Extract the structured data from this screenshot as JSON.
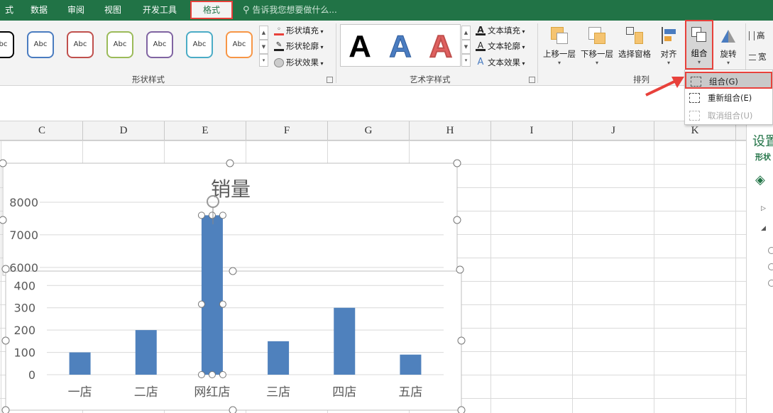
{
  "tabs": [
    {
      "label": "式",
      "active": false
    },
    {
      "label": "数据",
      "active": false
    },
    {
      "label": "审阅",
      "active": false
    },
    {
      "label": "视图",
      "active": false
    },
    {
      "label": "开发工具",
      "active": false
    },
    {
      "label": "格式",
      "active": true
    }
  ],
  "tell_me": "告诉我您想要做什么...",
  "ribbon": {
    "shape_styles": {
      "label": "形状样式",
      "swatches": [
        {
          "text": "Abc",
          "color": "#000000"
        },
        {
          "text": "Abc",
          "color": "#4a7cc0"
        },
        {
          "text": "Abc",
          "color": "#c0504d"
        },
        {
          "text": "Abc",
          "color": "#9bbb59"
        },
        {
          "text": "Abc",
          "color": "#8064a2"
        },
        {
          "text": "Abc",
          "color": "#4bacc6"
        },
        {
          "text": "Abc",
          "color": "#f79646"
        }
      ],
      "fill": "形状填充",
      "outline": "形状轮廓",
      "effects": "形状效果"
    },
    "wordart": {
      "label": "艺术字样式",
      "letters": [
        {
          "text": "A",
          "color": "#000000"
        },
        {
          "text": "A",
          "color": "#4a7cc0"
        },
        {
          "text": "A",
          "color": "#e06060"
        }
      ],
      "fill": "文本填充",
      "outline": "文本轮廓",
      "effects": "文本效果"
    },
    "arrange": {
      "label": "排列",
      "bring_forward": "上移一层",
      "send_backward": "下移一层",
      "selection_pane": "选择窗格",
      "align": "对齐",
      "group": "组合",
      "rotate": "旋转"
    },
    "size": {
      "height_label": "高",
      "width_label": "宽"
    }
  },
  "group_menu": [
    {
      "label": "组合(G)",
      "enabled": true,
      "highlight": true
    },
    {
      "label": "重新组合(E)",
      "enabled": true,
      "highlight": false
    },
    {
      "label": "取消组合(U)",
      "enabled": false,
      "highlight": false
    }
  ],
  "columns": [
    "C",
    "D",
    "E",
    "F",
    "G",
    "H",
    "I",
    "J",
    "K"
  ],
  "side_pane": {
    "title": "设置",
    "subtitle": "形状"
  },
  "colors": {
    "ribbon_green": "#217346",
    "highlight_red": "#e8413b",
    "bar": "#4f81bd"
  },
  "chart_data": {
    "type": "bar",
    "title": "销量",
    "categories": [
      "一店",
      "二店",
      "网红店",
      "三店",
      "四店",
      "五店"
    ],
    "values": [
      100,
      200,
      7600,
      150,
      300,
      90
    ],
    "upper_panel": {
      "ylim": [
        5800,
        8000
      ],
      "ticks": [
        6000,
        7000,
        8000
      ]
    },
    "lower_panel": {
      "ylim": [
        0,
        420
      ],
      "ticks": [
        0,
        100,
        200,
        300,
        400
      ]
    },
    "grid": true,
    "selected_category": "网红店"
  }
}
